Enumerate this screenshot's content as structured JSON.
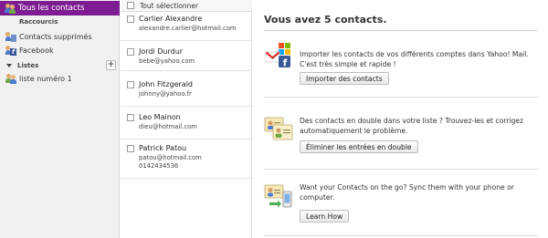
{
  "sidebar": {
    "active_item": "Tous les contacts",
    "shortcuts_heading": "Raccourcis",
    "shortcuts": [
      {
        "label": "Contacts supprimés",
        "icon": "deleted-contacts-icon"
      },
      {
        "label": "Facebook",
        "icon": "facebook-contacts-icon"
      }
    ],
    "lists_heading": "Listes",
    "add_list_label": "+",
    "lists": [
      {
        "label": "liste numéro 1",
        "icon": "contact-list-icon"
      }
    ]
  },
  "contact_list": {
    "select_all_label": "Tout sélectionner",
    "contacts": [
      {
        "name": "Carlier Alexandre",
        "details": [
          "alexandre.carlier@hotmail.com"
        ]
      },
      {
        "name": "Jordi Durdur",
        "details": [
          "bebe@yahoo.com"
        ]
      },
      {
        "name": "John Fitzgerald",
        "details": [
          "johnny@yahoo.fr"
        ]
      },
      {
        "name": "Leo Mainon",
        "details": [
          "dieu@hotmail.com"
        ]
      },
      {
        "name": "Patrick Patou",
        "details": [
          "patou@hotmail.com",
          "0142434536"
        ]
      }
    ]
  },
  "main": {
    "title": "Vous avez 5 contacts.",
    "sections": [
      {
        "icon": "import-contacts-icon",
        "text": "Importer les contacts de vos différents comptes dans Yahoo! Mail. C'est très simple et rapide !",
        "button": "Importer des contacts"
      },
      {
        "icon": "duplicate-contacts-icon",
        "text": "Des contacts en double dans votre liste ? Trouvez-les et corrigez automatiquement le problème.",
        "button": "Éliminer les entrées en double"
      },
      {
        "icon": "sync-contacts-icon",
        "text": "Want your Contacts on the go? Sync them with your phone or computer.",
        "button": "Learn How"
      }
    ]
  },
  "colors": {
    "active_item_bg": "#7d1d91",
    "sidebar_bg": "#f0f0f0"
  }
}
